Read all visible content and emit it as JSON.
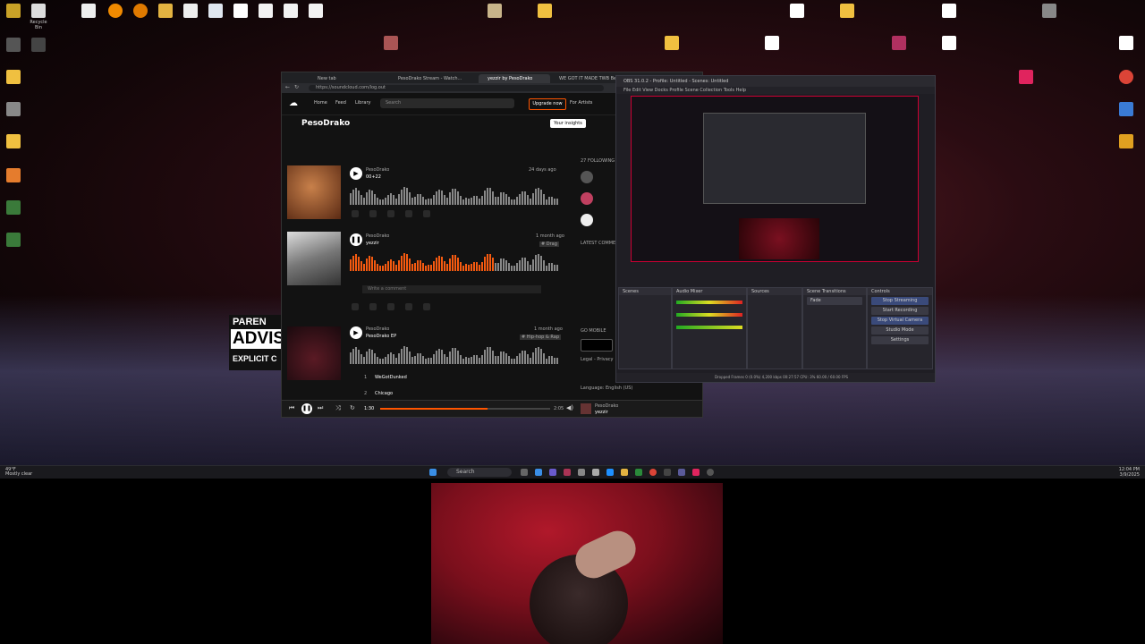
{
  "desktop": {
    "top_icons": [
      "",
      "Recycle Bin",
      "",
      "",
      "",
      "",
      "",
      "",
      "",
      "",
      "",
      "",
      ""
    ],
    "advisory": {
      "line1": "PAREN",
      "line2": "ADVIS",
      "line3": "EXPLICIT C"
    }
  },
  "taskbar": {
    "weather": "49°F",
    "weather_sub": "Mostly clear",
    "search_label": "Search",
    "time": "12:04 PM",
    "date": "3/9/2025"
  },
  "browser": {
    "tabs": [
      "New tab",
      "PesoDrako Stream - Watch...",
      "yezzir by PesoDrako",
      "WE GOT IT MADE TWB Be..."
    ],
    "url": "https://soundcloud.com/log.out",
    "nav": {
      "home": "Home",
      "feed": "Feed",
      "library": "Library",
      "search_placeholder": "Search",
      "upgrade": "Upgrade now",
      "for_artists": "For Artists"
    },
    "artist": "PesoDrako",
    "your_insights": "Your insights",
    "tracks": [
      {
        "artist": "PesoDrako",
        "title": "00+22",
        "age": "24 days ago"
      },
      {
        "artist": "PesoDrako",
        "title": "yezzir",
        "age": "1 month ago",
        "tag": "# Drag"
      },
      {
        "artist": "PesoDrako",
        "title": "PesoDrako EP",
        "age": "1 month ago",
        "tag": "# Hip-hop & Rap"
      }
    ],
    "comment_placeholder": "Write a comment",
    "playlist": [
      {
        "n": "1",
        "title": "WeGotDunked"
      },
      {
        "n": "2",
        "title": "Chicago"
      }
    ],
    "sidebar": {
      "following": "27 FOLLOWING",
      "latest": "LATEST COMMENTS",
      "mobile": "GO MOBILE",
      "language": "Language: English (US)",
      "legal": "Legal - Privacy"
    },
    "player": {
      "elapsed": "1:30",
      "total": "2:05",
      "now_artist": "PesoDrako",
      "now_title": "yezzir"
    }
  },
  "obs": {
    "title": "OBS 31.0.2 - Profile: Untitled - Scenes: Untitled",
    "menu": "File  Edit  View  Docks  Profile  Scene Collection  Tools  Help",
    "docks": [
      "Scenes",
      "Audio Mixer",
      "Sources",
      "Scene Transitions",
      "Controls"
    ],
    "controls": [
      "Stop Streaming",
      "Start Recording",
      "Stop Virtual Camera",
      "Studio Mode",
      "Settings"
    ],
    "transition": "Fade",
    "status": "Dropped Frames 0 (0.0%)   4,200 kbps   00:27:57   CPU: 3%   60.00 / 60.00 FPS"
  }
}
